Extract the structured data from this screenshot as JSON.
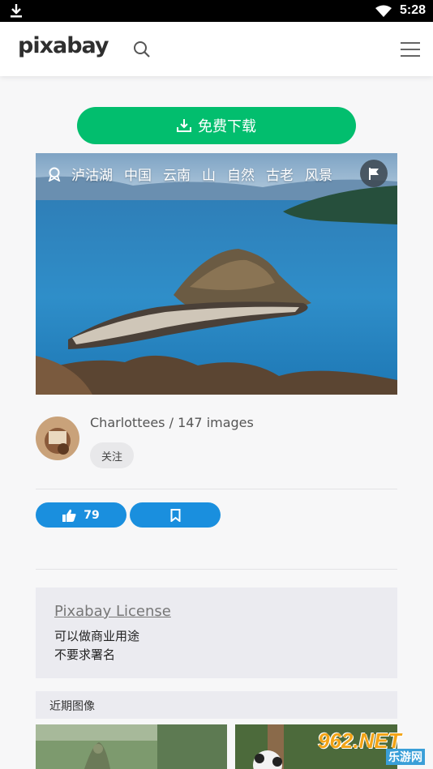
{
  "status_bar": {
    "time": "5:28",
    "icons": [
      "download-icon",
      "wifi-icon",
      "battery-icon"
    ]
  },
  "header": {
    "logo": "pixabay",
    "icons": [
      "search-icon",
      "menu-icon"
    ]
  },
  "download_button": {
    "label": "免费下载",
    "icon": "download-icon",
    "color": "#02be6e"
  },
  "photo": {
    "tags": [
      "泸沽湖",
      "中国",
      "云南",
      "山",
      "自然",
      "古老",
      "风景"
    ],
    "badge_icon": "award-icon",
    "flag_icon": "flag-icon"
  },
  "author": {
    "name_line": "Charlottees / 147 images",
    "follow_label": "关注"
  },
  "actions": {
    "like_count": "79",
    "like_icon": "thumbs-up-icon",
    "bookmark_icon": "bookmark-icon",
    "color": "#1a8fde"
  },
  "license": {
    "title": "Pixabay License",
    "line1": "可以做商业用途",
    "line2": "不要求署名"
  },
  "recent": {
    "title": "近期图像"
  },
  "watermark": {
    "big": "962.NET",
    "small": "乐游网"
  }
}
